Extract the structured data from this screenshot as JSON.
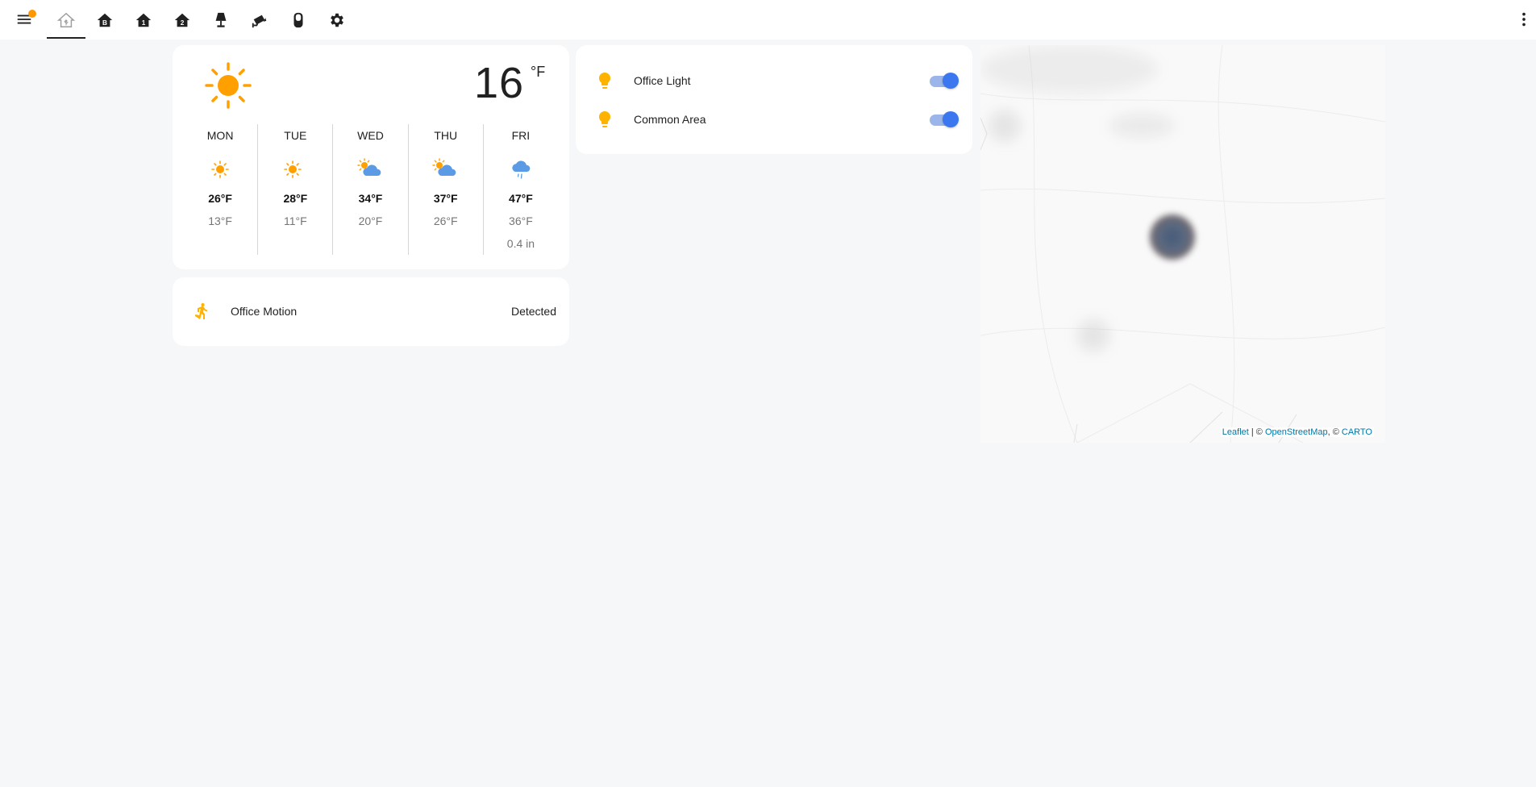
{
  "toolbar": {
    "tabs": [
      {
        "name": "home-tab",
        "icon": "home-assistant-icon",
        "active": true
      },
      {
        "name": "floor-basement-tab",
        "icon": "home-floor-b-icon"
      },
      {
        "name": "floor-1-tab",
        "icon": "home-floor-1-icon"
      },
      {
        "name": "floor-2-tab",
        "icon": "home-floor-2-icon"
      },
      {
        "name": "lamps-tab",
        "icon": "lamp-icon"
      },
      {
        "name": "cameras-tab",
        "icon": "cctv-icon"
      },
      {
        "name": "speaker-tab",
        "icon": "speaker-icon"
      },
      {
        "name": "settings-tab",
        "icon": "gear-icon"
      }
    ],
    "notification_color": "#ff9800"
  },
  "weather": {
    "current_temp": "16",
    "unit": "°F",
    "current_icon": "sunny-icon",
    "forecast": [
      {
        "day": "MON",
        "icon": "sunny-icon",
        "high": "26°F",
        "low": "13°F",
        "precip": ""
      },
      {
        "day": "TUE",
        "icon": "sunny-icon",
        "high": "28°F",
        "low": "11°F",
        "precip": ""
      },
      {
        "day": "WED",
        "icon": "partly-cloudy-icon",
        "high": "34°F",
        "low": "20°F",
        "precip": ""
      },
      {
        "day": "THU",
        "icon": "partly-cloudy-icon",
        "high": "37°F",
        "low": "26°F",
        "precip": ""
      },
      {
        "day": "FRI",
        "icon": "rainy-icon",
        "high": "47°F",
        "low": "36°F",
        "precip": "0.4 in"
      }
    ]
  },
  "motion": {
    "name": "Office Motion",
    "state": "Detected",
    "icon": "motion-sensor-icon"
  },
  "lights": [
    {
      "name": "Office Light",
      "icon": "lightbulb-icon",
      "on": true
    },
    {
      "name": "Common Area",
      "icon": "lightbulb-icon",
      "on": true
    }
  ],
  "map": {
    "attribution": {
      "leaflet": "Leaflet",
      "sep1": " | © ",
      "osm": "OpenStreetMap",
      "sep2": ", © ",
      "carto": "CARTO"
    }
  },
  "colors": {
    "accent": "#3b78f0",
    "icon_active": "#ffb300",
    "sun": "#ffa000",
    "cloud": "#5b9be6"
  }
}
